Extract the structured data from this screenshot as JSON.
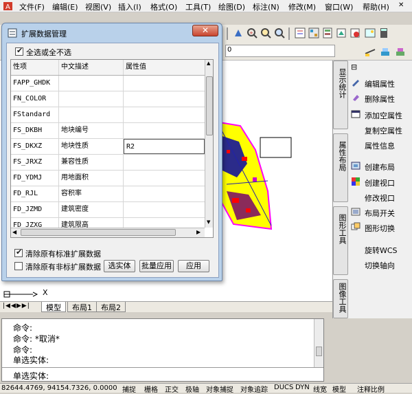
{
  "menu": {
    "items": [
      "文件(F)",
      "编辑(E)",
      "视图(V)",
      "插入(I)",
      "格式(O)",
      "工具(T)",
      "绘图(D)",
      "标注(N)",
      "修改(M)",
      "窗口(W)",
      "帮助(H)"
    ]
  },
  "dialog": {
    "title": "扩展数据管理",
    "select_all_label": "全选或全不选",
    "columns": [
      "性项",
      "中文描述",
      "属性值"
    ],
    "rows": [
      {
        "key": "FAPP_GHDK",
        "desc": "",
        "value": ""
      },
      {
        "key": "FN_COLOR",
        "desc": "",
        "value": ""
      },
      {
        "key": "FStandard",
        "desc": "",
        "value": ""
      },
      {
        "key": "FS_DKBH",
        "desc": "地块编号",
        "value": ""
      },
      {
        "key": "FS_DKXZ",
        "desc": "地块性质",
        "value": "R2"
      },
      {
        "key": "FS_JRXZ",
        "desc": "兼容性质",
        "value": ""
      },
      {
        "key": "FD_YDMJ",
        "desc": "用地面积",
        "value": ""
      },
      {
        "key": "FD_RJL",
        "desc": "容积率",
        "value": ""
      },
      {
        "key": "FD_JZMD",
        "desc": "建筑密度",
        "value": ""
      },
      {
        "key": "FD_JZXG",
        "desc": "建筑限高",
        "value": ""
      }
    ],
    "clear_standard_label": "清除原有标准扩展数据",
    "clear_nonstandard_label": "清除原有非标扩展数据",
    "select_entity_btn": "选实体",
    "batch_apply_btn": "批量应用",
    "apply_btn": "应用"
  },
  "side_panel": {
    "tabs": [
      "显示统计",
      "属性布局",
      "图形工具",
      "图像工具"
    ],
    "items": [
      "编辑属性",
      "删除属性",
      "添加空属性",
      "复制空属性",
      "属性信息",
      "创建布局",
      "创建视口",
      "修改视口",
      "布局开关",
      "图形切换",
      "旋转WCS",
      "切换轴向"
    ]
  },
  "layout_tabs": [
    "模型",
    "布局1",
    "布局2"
  ],
  "axis": {
    "x": "X"
  },
  "command": {
    "lines": [
      "命令:",
      "命令: *取消*",
      "命令:",
      "单选实体:"
    ],
    "prompt": "单选实体:"
  },
  "status": {
    "coords": "82644.4769, 94154.7326, 0.0000",
    "buttons": [
      "捕捉",
      "栅格",
      "正交",
      "极轴",
      "对象捕捉",
      "对象追踪",
      "DUCS",
      "DYN",
      "线宽",
      "模型",
      "注释比例"
    ]
  }
}
